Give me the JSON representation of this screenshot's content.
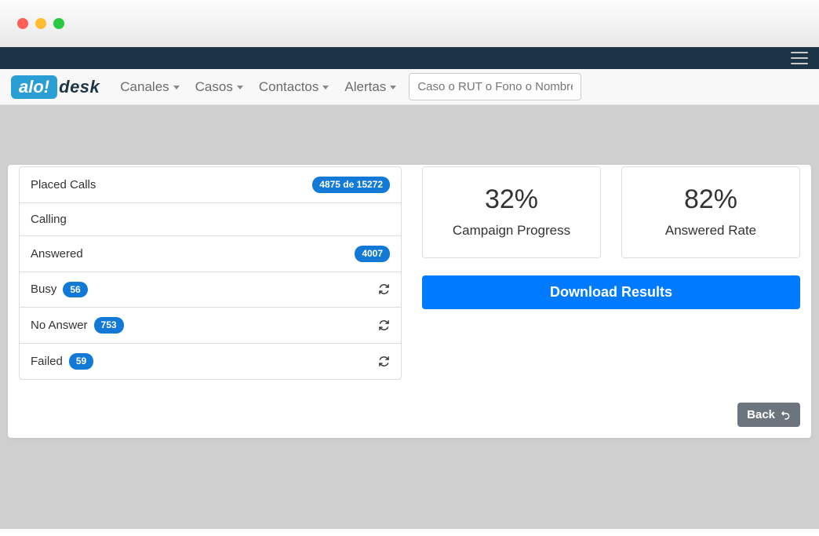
{
  "nav": {
    "items": [
      "Canales",
      "Casos",
      "Contactos",
      "Alertas"
    ],
    "search_placeholder": "Caso o RUT o Fono o Nombre"
  },
  "logo": {
    "bubble": "alo!",
    "text": "desk"
  },
  "call_status": {
    "placed_calls": {
      "label": "Placed Calls",
      "badge": "4875 de 15272"
    },
    "calling": {
      "label": "Calling"
    },
    "answered": {
      "label": "Answered",
      "badge": "4007"
    },
    "busy": {
      "label": "Busy",
      "badge": "56"
    },
    "no_answer": {
      "label": "No Answer",
      "badge": "753"
    },
    "failed": {
      "label": "Failed",
      "badge": "59"
    }
  },
  "stats": {
    "progress": {
      "value": "32%",
      "label": "Campaign Progress"
    },
    "answered_rate": {
      "value": "82%",
      "label": "Answered Rate"
    }
  },
  "buttons": {
    "download": "Download Results",
    "back": "Back"
  }
}
